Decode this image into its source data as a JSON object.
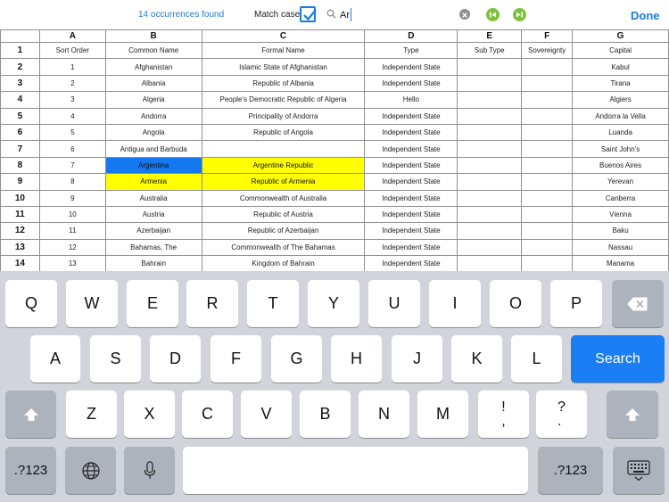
{
  "toolbar": {
    "occurrences": "14 occurrences found",
    "match_case_label": "Match case",
    "match_case_checked": true,
    "search_query": "Ar",
    "done_label": "Done",
    "accent_color": "#1a7be6",
    "nav_color": "#7ec23b",
    "icons": [
      "search-icon",
      "clear-icon",
      "previous-icon",
      "next-icon",
      "checkbox-check-icon"
    ]
  },
  "sheet": {
    "columns": [
      "A",
      "B",
      "C",
      "D",
      "E",
      "F",
      "G"
    ],
    "rows": [
      {
        "num": "1",
        "cells": [
          "Sort Order",
          "Common Name",
          "Formal Name",
          "Type",
          "Sub Type",
          "Sovereignty",
          "Capital"
        ]
      },
      {
        "num": "2",
        "cells": [
          "1",
          "Afghanistan",
          "Islamic State of Afghanistan",
          "Independent State",
          "",
          "",
          "Kabul"
        ]
      },
      {
        "num": "3",
        "cells": [
          "2",
          "Albania",
          "Republic of Albania",
          "Independent State",
          "",
          "",
          "Tirana"
        ]
      },
      {
        "num": "4",
        "cells": [
          "3",
          "Algeria",
          "People's Democratic Republic of Algeria",
          "Hello",
          "",
          "",
          "Algiers"
        ]
      },
      {
        "num": "5",
        "cells": [
          "4",
          "Andorra",
          "Principality of Andorra",
          "Independent State",
          "",
          "",
          "Andorra la Vella"
        ]
      },
      {
        "num": "6",
        "cells": [
          "5",
          "Angola",
          "Republic of Angola",
          "Independent State",
          "",
          "",
          "Luanda"
        ]
      },
      {
        "num": "7",
        "cells": [
          "6",
          "Antigua and Barbuda",
          "",
          "Independent State",
          "",
          "",
          "Saint John's"
        ]
      },
      {
        "num": "8",
        "cells": [
          "7",
          "Argentina",
          "Argentine Republic",
          "Independent State",
          "",
          "",
          "Buenos Aires"
        ]
      },
      {
        "num": "9",
        "cells": [
          "8",
          "Armenia",
          "Republic of Armenia",
          "Independent State",
          "",
          "",
          "Yerevan"
        ]
      },
      {
        "num": "10",
        "cells": [
          "9",
          "Australia",
          "Commonwealth of Australia",
          "Independent State",
          "",
          "",
          "Canberra"
        ]
      },
      {
        "num": "11",
        "cells": [
          "10",
          "Austria",
          "Republic of Austria",
          "Independent State",
          "",
          "",
          "Vienna"
        ]
      },
      {
        "num": "12",
        "cells": [
          "11",
          "Azerbaijan",
          "Republic of Azerbaijan",
          "Independent State",
          "",
          "",
          "Baku"
        ]
      },
      {
        "num": "13",
        "cells": [
          "12",
          "Bahamas, The",
          "Commonwealth of The Bahamas",
          "Independent State",
          "",
          "",
          "Nassau"
        ]
      },
      {
        "num": "14",
        "cells": [
          "13",
          "Bahrain",
          "Kingdom of Bahrain",
          "Independent State",
          "",
          "",
          "Manama"
        ]
      }
    ],
    "highlight_colors": {
      "current_match": "#1478f0",
      "match": "#ffff00"
    }
  },
  "keyboard": {
    "row1": [
      "Q",
      "W",
      "E",
      "R",
      "T",
      "Y",
      "U",
      "I",
      "O",
      "P"
    ],
    "row2": [
      "A",
      "S",
      "D",
      "F",
      "G",
      "H",
      "J",
      "K",
      "L"
    ],
    "row3": [
      "Z",
      "X",
      "C",
      "V",
      "B",
      "N",
      "M",
      "!\n,",
      "?\n."
    ],
    "search_label": "Search",
    "numbers_label": ".?123",
    "icons": [
      "backspace-icon",
      "shift-icon",
      "globe-icon",
      "microphone-icon",
      "keyboard-dismiss-icon"
    ]
  }
}
